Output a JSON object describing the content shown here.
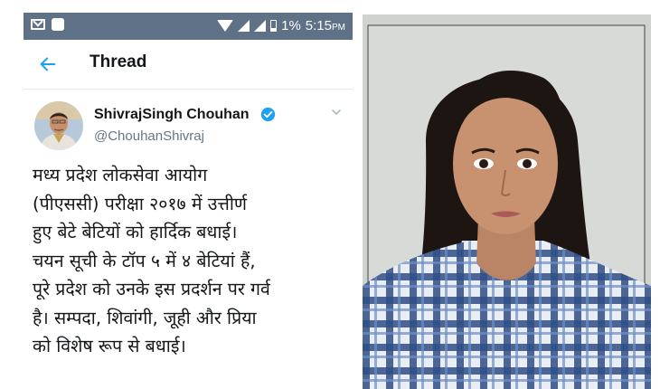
{
  "status_bar": {
    "battery": "1%",
    "time": "5:15",
    "time_suffix": "PM"
  },
  "header": {
    "title": "Thread"
  },
  "tweet": {
    "author_name": "ShivrajSingh Chouhan",
    "author_handle": "@ChouhanShivraj",
    "verified": true,
    "text": "मध्य प्रदेश लोकसेवा आयोग\n(पीएससी) परीक्षा २०१७ में उत्तीर्ण\nहुए बेटे बेटियों को हार्दिक बधाई।\nचयन सूची के टॉप ५ में ४ बेटियां हैं,\nपूरे प्रदेश को उनके इस प्रदर्शन पर गर्व\nहै। सम्पदा, शिवांगी, जूही और प्रिया\nको विशेष रूप से बधाई।"
  },
  "colors": {
    "status_bar": "#5e7186",
    "accent": "#1da1f2",
    "handle_gray": "#657786"
  },
  "icons": [
    "mail-icon",
    "notification-square-icon",
    "wifi-icon",
    "signal-icon",
    "battery-icon",
    "back-arrow-icon",
    "verified-badge-icon",
    "chevron-down-icon"
  ]
}
